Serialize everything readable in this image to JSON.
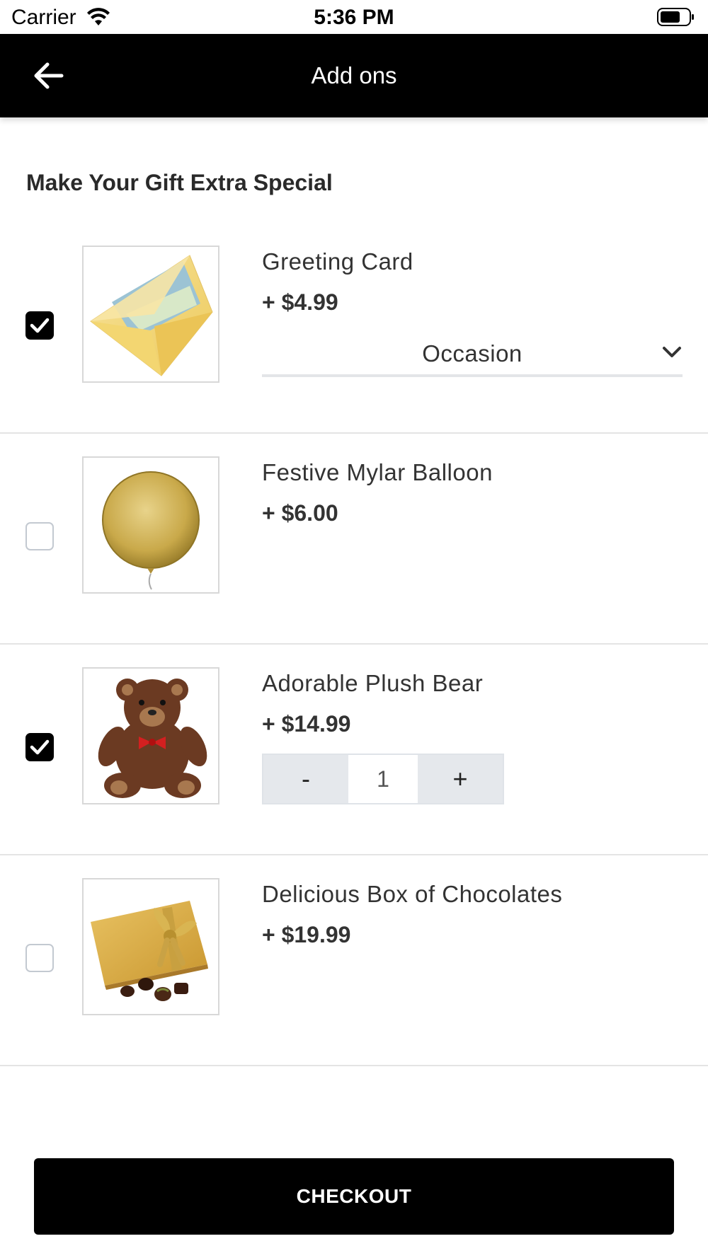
{
  "status_bar": {
    "carrier": "Carrier",
    "time": "5:36 PM"
  },
  "header": {
    "title": "Add ons",
    "back_icon": "arrow-left-icon"
  },
  "section": {
    "heading": "Make Your Gift Extra Special"
  },
  "items": [
    {
      "name": "Greeting Card",
      "price": "+ $4.99",
      "checked": true,
      "image": "greeting-card-envelope",
      "select_label": "Occasion"
    },
    {
      "name": "Festive Mylar Balloon",
      "price": "+ $6.00",
      "checked": false,
      "image": "gold-mylar-balloon"
    },
    {
      "name": "Adorable Plush Bear",
      "price": "+ $14.99",
      "checked": true,
      "image": "plush-teddy-bear",
      "stepper": {
        "minus": "-",
        "quantity": "1",
        "plus": "+"
      }
    },
    {
      "name": "Delicious Box of Chocolates",
      "price": "+ $19.99",
      "checked": false,
      "image": "gold-chocolate-box"
    }
  ],
  "footer": {
    "checkout_label": "CHECKOUT"
  },
  "colors": {
    "header_bg": "#000000",
    "button_bg": "#000000",
    "checkbox_checked": "#000000",
    "divider": "#e4e4e4",
    "stepper_bg": "#e5e8ec"
  }
}
